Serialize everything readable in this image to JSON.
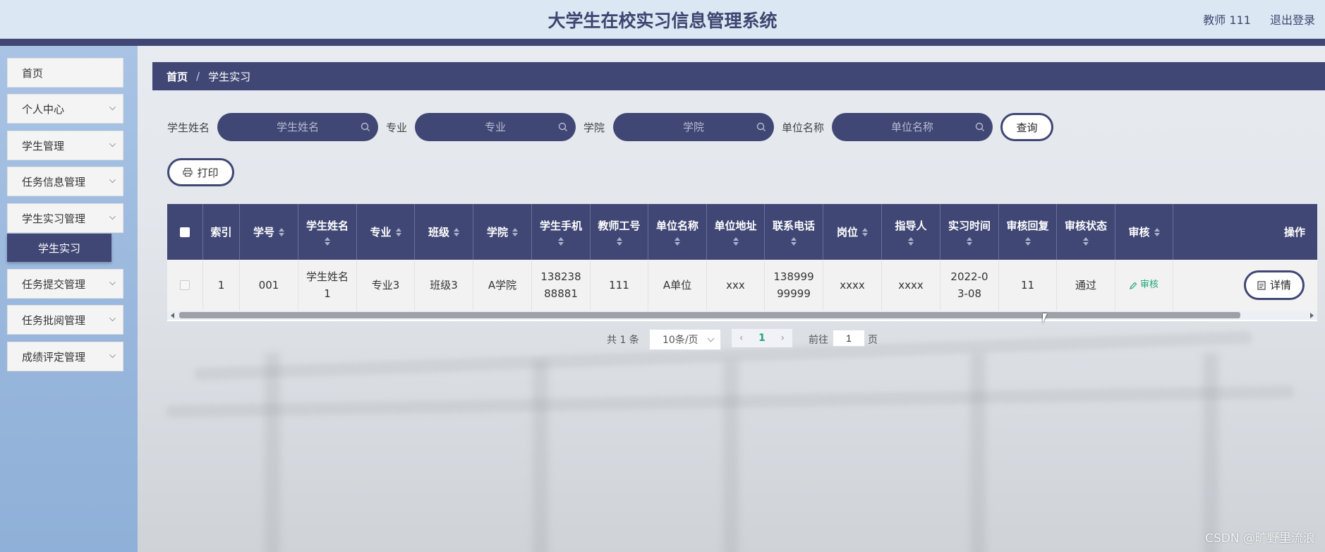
{
  "header": {
    "title": "大学生在校实习信息管理系统",
    "user": "教师 111",
    "logout": "退出登录"
  },
  "sidebar": {
    "items": [
      {
        "label": "首页",
        "has_arrow": false
      },
      {
        "label": "个人中心",
        "has_arrow": true
      },
      {
        "label": "学生管理",
        "has_arrow": true
      },
      {
        "label": "任务信息管理",
        "has_arrow": true
      },
      {
        "label": "学生实习管理",
        "has_arrow": true
      },
      {
        "label": "任务提交管理",
        "has_arrow": true
      },
      {
        "label": "任务批阅管理",
        "has_arrow": true
      },
      {
        "label": "成绩评定管理",
        "has_arrow": true
      }
    ],
    "active_submenu": "学生实习"
  },
  "breadcrumb": {
    "home": "首页",
    "separator": "/",
    "current": "学生实习"
  },
  "search": {
    "fields": [
      {
        "label": "学生姓名",
        "placeholder": "学生姓名"
      },
      {
        "label": "专业",
        "placeholder": "专业"
      },
      {
        "label": "学院",
        "placeholder": "学院"
      },
      {
        "label": "单位名称",
        "placeholder": "单位名称"
      }
    ],
    "query_button": "查询"
  },
  "toolbar": {
    "print_label": "打印"
  },
  "table": {
    "headers": [
      "索引",
      "学号",
      "学生姓名",
      "专业",
      "班级",
      "学院",
      "学生手机",
      "教师工号",
      "单位名称",
      "单位地址",
      "联系电话",
      "岗位",
      "指导人",
      "实习时间",
      "审核回复",
      "审核状态",
      "审核",
      "操作"
    ],
    "rows": [
      {
        "index": "1",
        "student_no": "001",
        "student_name": "学生姓名1",
        "major": "专业3",
        "class": "班级3",
        "college": "A学院",
        "phone": "13823888881",
        "teacher_no": "111",
        "company": "A单位",
        "address": "xxx",
        "contact": "13899999999",
        "post": "xxxx",
        "mentor": "xxxx",
        "date": "2022-03-08",
        "reply": "11",
        "status": "通过",
        "audit_label": "审核",
        "detail_label": "详情"
      }
    ]
  },
  "pagination": {
    "total": "共 1 条",
    "page_size": "10条/页",
    "current_page": "1",
    "goto_label": "前往",
    "goto_value": "1",
    "unit": "页"
  },
  "watermark": "CSDN @旷野里流浪",
  "colors": {
    "primary": "#404774",
    "accent_green": "#20a57a",
    "header_bg": "#dbe8f3",
    "sidebar_bg": "#9ab7dd"
  }
}
